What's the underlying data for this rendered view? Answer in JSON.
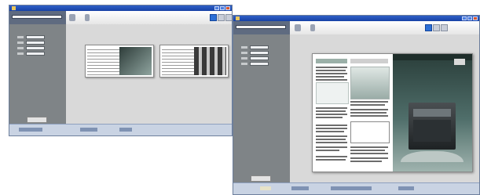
{
  "window1": {
    "title": " ",
    "toolbar": {
      "tools": [
        {
          "icon": "navigate-icon"
        },
        {
          "icon": "zoom-icon"
        }
      ],
      "view_modes": [
        {
          "icon": "single-page-view-icon",
          "active": true
        },
        {
          "icon": "two-page-view-icon",
          "active": false
        },
        {
          "icon": "thumbnail-view-icon",
          "active": false
        }
      ]
    },
    "sidebar_fields": 4,
    "thumbnails": 2
  },
  "window2": {
    "title": " ",
    "toolbar": {
      "tools": [
        {
          "icon": "navigate-icon"
        },
        {
          "icon": "zoom-icon"
        }
      ],
      "view_modes": [
        {
          "icon": "single-page-view-icon",
          "active": true
        },
        {
          "icon": "two-page-view-icon",
          "active": false
        },
        {
          "icon": "thumbnail-view-icon",
          "active": false
        }
      ]
    },
    "document": {
      "brochure_cover_heading": " "
    }
  },
  "colors": {
    "titlebar": "#1742a6",
    "sidebar": "#7f8487",
    "workspace": "#d9d9d9",
    "brochure_cover": "#2a3e3a",
    "active_view": "#2c6fd6"
  }
}
